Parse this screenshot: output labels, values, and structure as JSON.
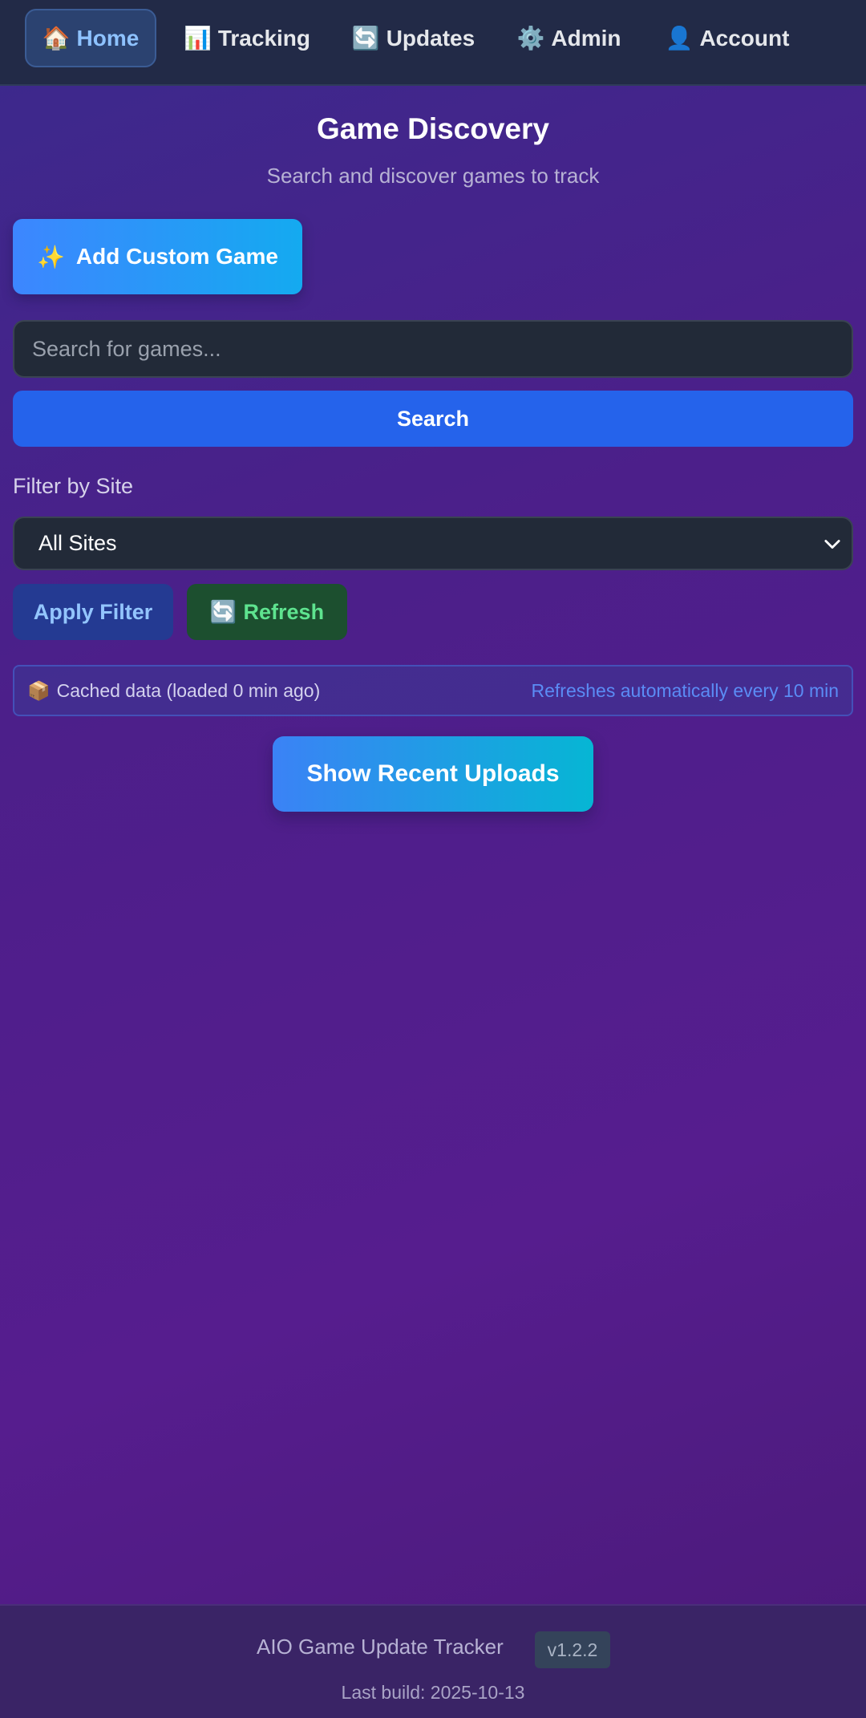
{
  "nav": {
    "items": [
      {
        "icon": "🏠",
        "label": "Home",
        "active": true
      },
      {
        "icon": "📊",
        "label": "Tracking"
      },
      {
        "icon": "🔄",
        "label": "Updates"
      },
      {
        "icon": "⚙️",
        "label": "Admin"
      },
      {
        "icon": "👤",
        "label": "Account"
      }
    ]
  },
  "header": {
    "title": "Game Discovery",
    "subtitle": "Search and discover games to track"
  },
  "custom_game": {
    "icon": "✨",
    "label": "Add Custom Game"
  },
  "search": {
    "placeholder": "Search for games...",
    "value": "",
    "button_label": "Search"
  },
  "filter": {
    "label": "Filter by Site",
    "selected": "All Sites",
    "apply_label": "Apply Filter",
    "refresh_icon": "🔄",
    "refresh_label": "Refresh"
  },
  "cache": {
    "icon": "📦",
    "status": "Cached data (loaded 0 min ago)",
    "note": "Refreshes automatically every 10 min"
  },
  "recent": {
    "label": "Show Recent Uploads"
  },
  "footer": {
    "app_name": "AIO Game Update Tracker",
    "version": "v1.2.2",
    "build": "Last build: 2025-10-13"
  },
  "colors": {
    "nav_bg": "#222a47",
    "primary": "#2563eb",
    "refresh_green": "#5ee38f",
    "link_blue": "#5b8cf5"
  }
}
